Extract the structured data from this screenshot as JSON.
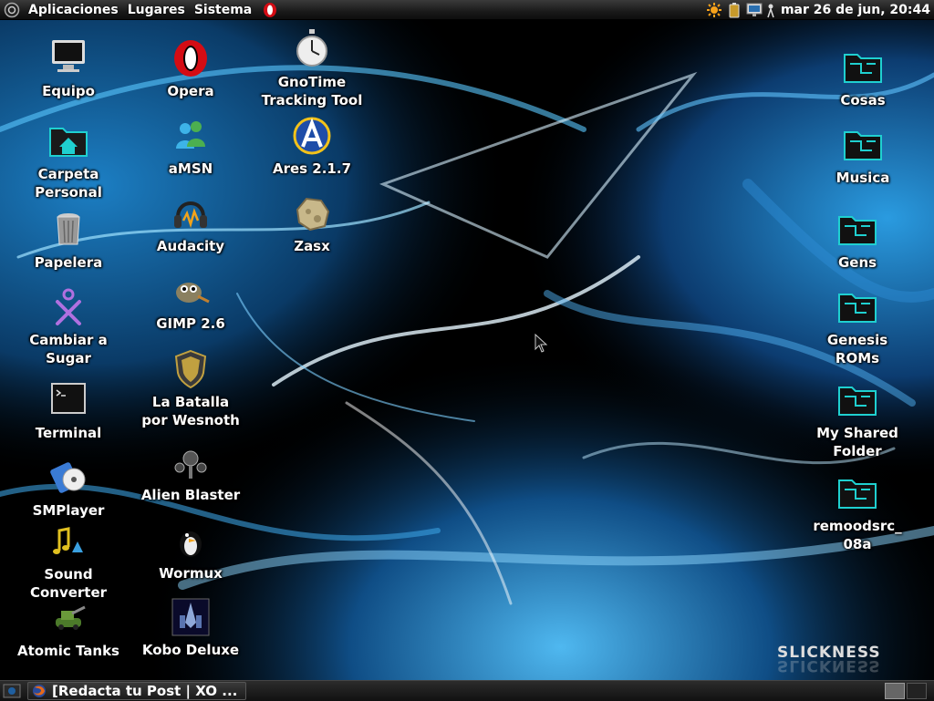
{
  "top_panel": {
    "menus": [
      "Aplicaciones",
      "Lugares",
      "Sistema"
    ],
    "clock": "mar 26 de jun, 20:44"
  },
  "desktop": {
    "col1": [
      {
        "label": "Equipo",
        "icon": "computer-icon"
      },
      {
        "label": "Carpeta\nPersonal",
        "icon": "home-folder-icon"
      },
      {
        "label": "Papelera",
        "icon": "trash-icon"
      },
      {
        "label": "Cambiar a\nSugar",
        "icon": "sugar-icon"
      },
      {
        "label": "Terminal",
        "icon": "terminal-icon"
      },
      {
        "label": "SMPlayer",
        "icon": "smplayer-icon"
      },
      {
        "label": "Sound\nConverter",
        "icon": "sound-converter-icon"
      },
      {
        "label": "Atomic Tanks",
        "icon": "tank-icon"
      }
    ],
    "col2": [
      {
        "label": "Opera",
        "icon": "opera-icon"
      },
      {
        "label": "aMSN",
        "icon": "amsn-icon"
      },
      {
        "label": "Audacity",
        "icon": "audacity-icon"
      },
      {
        "label": "GIMP 2.6",
        "icon": "gimp-icon"
      },
      {
        "label": "La Batalla\npor Wesnoth",
        "icon": "wesnoth-icon"
      },
      {
        "label": "Alien Blaster",
        "icon": "alien-blaster-icon"
      },
      {
        "label": "Wormux",
        "icon": "wormux-icon"
      },
      {
        "label": "Kobo Deluxe",
        "icon": "kobo-deluxe-icon"
      }
    ],
    "col3": [
      {
        "label": "GnoTime\nTracking Tool",
        "icon": "stopwatch-icon"
      },
      {
        "label": "Ares 2.1.7",
        "icon": "ares-icon"
      },
      {
        "label": "Zasx",
        "icon": "asteroid-icon"
      }
    ],
    "col4": [
      {
        "label": "Cosas",
        "icon": "folder-icon"
      },
      {
        "label": "Musica",
        "icon": "folder-icon"
      },
      {
        "label": "Gens",
        "icon": "folder-icon"
      },
      {
        "label": "Genesis\nROMs",
        "icon": "folder-icon"
      },
      {
        "label": "My Shared\nFolder",
        "icon": "folder-icon"
      },
      {
        "label": "remoodsrc_\n08a",
        "icon": "folder-icon"
      }
    ]
  },
  "bottom_panel": {
    "task_title": "[Redacta tu Post | XO ..."
  },
  "branding": "SLICKNESS",
  "colors": {
    "folder_accent": "#1fd0d0",
    "opera_red": "#d40c14",
    "panel_bg": "#1a1a1a"
  }
}
